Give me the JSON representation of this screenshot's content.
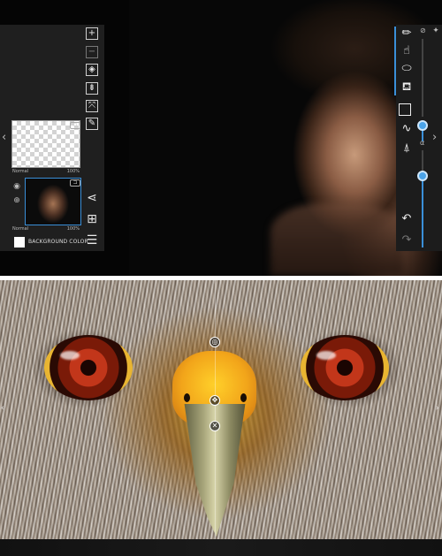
{
  "top_app": {
    "left_panel": {
      "layers": [
        {
          "mode": "Normal",
          "opacity": "100%"
        },
        {
          "mode": "Normal",
          "opacity": "100%"
        }
      ],
      "background_label": "BACKGROUND COLOR"
    },
    "right_panel": {
      "alpha_symbol": "α"
    }
  },
  "colors": {
    "accent": "#3a8fd8",
    "panel": "#1f1f1f",
    "separator": "#ffffff"
  },
  "icons": [
    "pin-icon",
    "add-layer-icon",
    "delete-layer-icon",
    "duplicate-layer-icon",
    "merge-layer-icon",
    "transform-icon",
    "fill-icon",
    "share-icon",
    "grid-icon",
    "adjust-icon",
    "brush-icon",
    "smudge-icon",
    "eraser-icon",
    "bucket-icon",
    "color-swatch-icon",
    "stroke-icon",
    "perspective-icon",
    "undo-icon",
    "redo-icon"
  ]
}
